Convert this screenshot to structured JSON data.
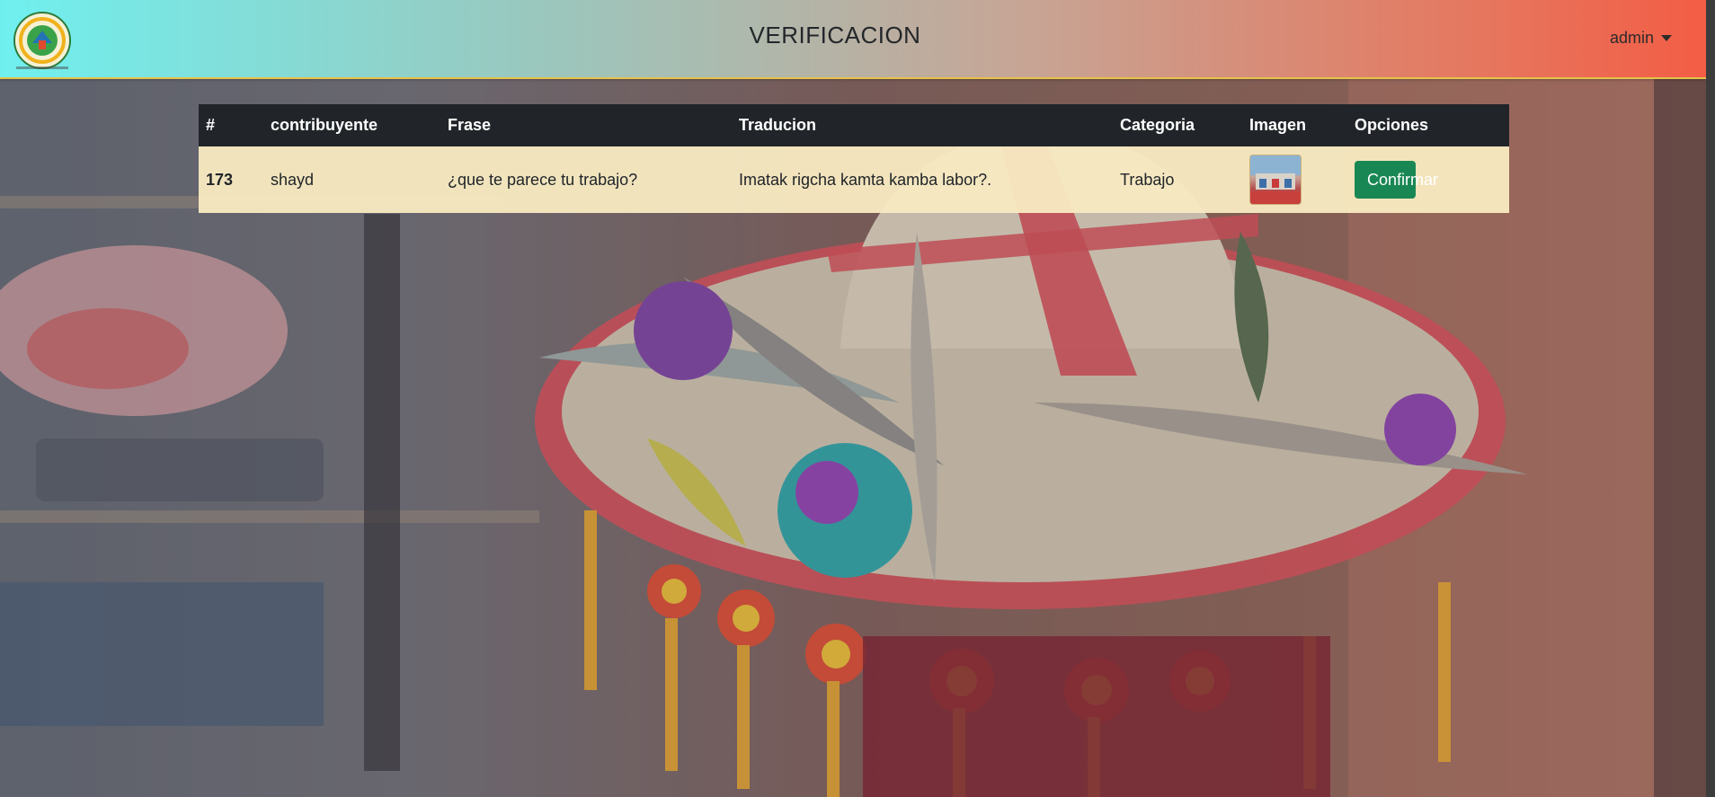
{
  "header": {
    "title": "VERIFICACION",
    "user_menu_label": "admin"
  },
  "table": {
    "columns": [
      "#",
      "contribuyente",
      "Frase",
      "Traducion",
      "Categoria",
      "Imagen",
      "Opciones"
    ],
    "rows": [
      {
        "id": "173",
        "contributor": "shayd",
        "phrase": "¿que te parece tu trabajo?",
        "translation": "Imatak rigcha kamta kamba labor?.",
        "category": "Trabajo",
        "action_label": "Confirmar"
      }
    ]
  },
  "colors": {
    "navbar_start": "#6ff0ef",
    "navbar_end": "#f35d45",
    "table_header": "#212529",
    "row_background": "#f7e9c1",
    "confirm_button": "#198754"
  },
  "icons": {
    "logo": "organization-logo",
    "user_menu": "caret-down-icon"
  }
}
